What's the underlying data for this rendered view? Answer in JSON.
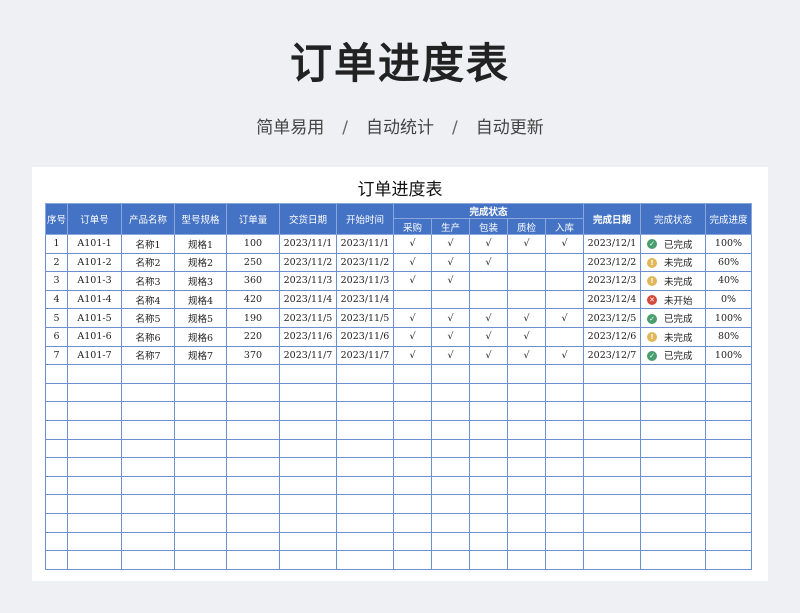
{
  "hero": {
    "title": "订单进度表",
    "tags": [
      "简单易用",
      "自动统计",
      "自动更新"
    ],
    "separator": "/"
  },
  "sheet": {
    "title": "订单进度表",
    "headers": {
      "seq": "序号",
      "order_no": "订单号",
      "product": "产品名称",
      "model": "型号规格",
      "qty": "订单量",
      "delivery": "交货日期",
      "start": "开始时间",
      "stage_group": "完成状态",
      "stages": [
        "采购",
        "生产",
        "包装",
        "质检",
        "入库"
      ],
      "done_date": "完成日期",
      "status": "完成状态",
      "progress": "完成进度"
    },
    "rows": [
      {
        "seq": "1",
        "order_no": "A101-1",
        "product": "名称1",
        "model": "规格1",
        "qty": "100",
        "delivery": "2023/11/1",
        "start": "2023/11/1",
        "stages": [
          "√",
          "√",
          "√",
          "√",
          "√"
        ],
        "done_date": "2023/12/1",
        "status_icon": "check-circle-icon",
        "status": "已完成",
        "progress": "100%"
      },
      {
        "seq": "2",
        "order_no": "A101-2",
        "product": "名称2",
        "model": "规格2",
        "qty": "250",
        "delivery": "2023/11/2",
        "start": "2023/11/2",
        "stages": [
          "√",
          "√",
          "√",
          "",
          ""
        ],
        "done_date": "2023/12/2",
        "status_icon": "exclamation-circle-icon",
        "status": "未完成",
        "progress": "60%"
      },
      {
        "seq": "3",
        "order_no": "A101-3",
        "product": "名称3",
        "model": "规格3",
        "qty": "360",
        "delivery": "2023/11/3",
        "start": "2023/11/3",
        "stages": [
          "√",
          "√",
          "",
          "",
          ""
        ],
        "done_date": "2023/12/3",
        "status_icon": "exclamation-circle-icon",
        "status": "未完成",
        "progress": "40%"
      },
      {
        "seq": "4",
        "order_no": "A101-4",
        "product": "名称4",
        "model": "规格4",
        "qty": "420",
        "delivery": "2023/11/4",
        "start": "2023/11/4",
        "stages": [
          "",
          "",
          "",
          "",
          ""
        ],
        "done_date": "2023/12/4",
        "status_icon": "cross-circle-icon",
        "status": "未开始",
        "progress": "0%"
      },
      {
        "seq": "5",
        "order_no": "A101-5",
        "product": "名称5",
        "model": "规格5",
        "qty": "190",
        "delivery": "2023/11/5",
        "start": "2023/11/5",
        "stages": [
          "√",
          "√",
          "√",
          "√",
          "√"
        ],
        "done_date": "2023/12/5",
        "status_icon": "check-circle-icon",
        "status": "已完成",
        "progress": "100%"
      },
      {
        "seq": "6",
        "order_no": "A101-6",
        "product": "名称6",
        "model": "规格6",
        "qty": "220",
        "delivery": "2023/11/6",
        "start": "2023/11/6",
        "stages": [
          "√",
          "√",
          "√",
          "√",
          ""
        ],
        "done_date": "2023/12/6",
        "status_icon": "exclamation-circle-icon",
        "status": "未完成",
        "progress": "80%"
      },
      {
        "seq": "7",
        "order_no": "A101-7",
        "product": "名称7",
        "model": "规格7",
        "qty": "370",
        "delivery": "2023/11/7",
        "start": "2023/11/7",
        "stages": [
          "√",
          "√",
          "√",
          "√",
          "√"
        ],
        "done_date": "2023/12/7",
        "status_icon": "check-circle-icon",
        "status": "已完成",
        "progress": "100%"
      }
    ],
    "empty_rows": 11
  },
  "colors": {
    "header_bg": "#4472c4",
    "grid": "#6e8fcf",
    "done": "#4a9e6e",
    "pending": "#e2b75a",
    "not_started": "#d44a3a"
  }
}
